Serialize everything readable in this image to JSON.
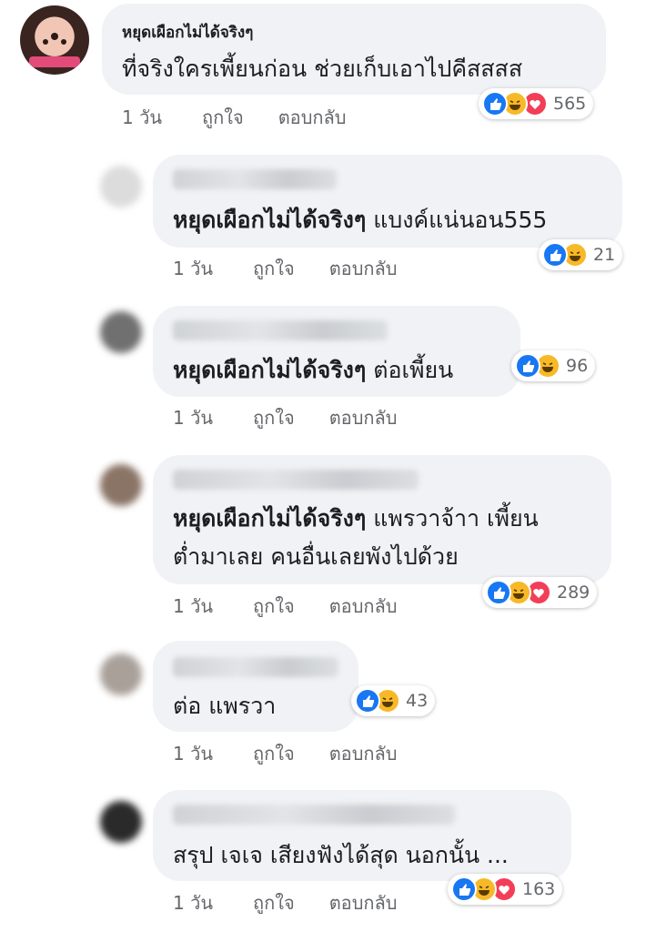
{
  "comments": [
    {
      "name": "หยุดเผือกไม่ได้จริงๆ",
      "text": "ที่จริงใครเพี้ยนก่อน ช่วยเก็บเอาไปคีสสสส",
      "time": "1 วัน",
      "like": "ถูกใจ",
      "reply": "ตอบกลับ",
      "reactions": [
        "like",
        "haha",
        "love"
      ],
      "count": "565"
    },
    {
      "mention": "หยุดเผือกไม่ได้จริงๆ",
      "text": " แบงค์แน่นอน555",
      "time": "1 วัน",
      "like": "ถูกใจ",
      "reply": "ตอบกลับ",
      "reactions": [
        "like",
        "haha"
      ],
      "count": "21"
    },
    {
      "mention": "หยุดเผือกไม่ได้จริงๆ",
      "text": " ต่อเพี้ยน",
      "time": "1 วัน",
      "like": "ถูกใจ",
      "reply": "ตอบกลับ",
      "reactions": [
        "like",
        "haha"
      ],
      "count": "96"
    },
    {
      "mention": "หยุดเผือกไม่ได้จริงๆ",
      "text": " แพรวาจ้าา เพี้ยน",
      "text2": "ต่ำมาเลย คนอื่นเลยพังไปด้วย",
      "time": "1 วัน",
      "like": "ถูกใจ",
      "reply": "ตอบกลับ",
      "reactions": [
        "like",
        "haha",
        "love"
      ],
      "count": "289"
    },
    {
      "text": "ต่อ แพรวา",
      "time": "1 วัน",
      "like": "ถูกใจ",
      "reply": "ตอบกลับ",
      "reactions": [
        "like",
        "haha"
      ],
      "count": "43"
    },
    {
      "text": "สรุป เจเจ เสียงฟังได้สุด นอกนั้น ...",
      "time": "1 วัน",
      "like": "ถูกใจ",
      "reply": "ตอบกลับ",
      "reactions": [
        "like",
        "haha",
        "love"
      ],
      "count": "163"
    }
  ],
  "colors": {
    "like": "#1877f2",
    "haha": "#f7b928",
    "love": "#f33e58",
    "bubble": "#f0f2f5"
  }
}
